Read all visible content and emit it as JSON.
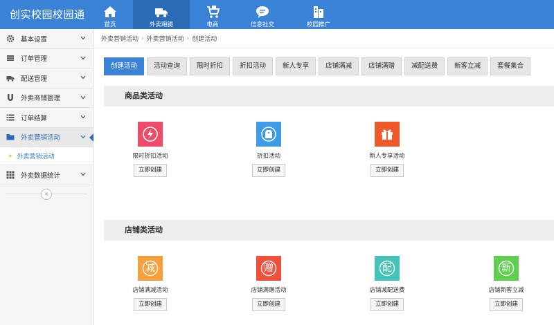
{
  "brand": "创实校园校园通",
  "topnav": [
    {
      "label": "首页",
      "icon": "home-icon"
    },
    {
      "label": "外卖跑腿",
      "icon": "delivery-truck-icon",
      "active": true
    },
    {
      "label": "电商",
      "icon": "cart-icon"
    },
    {
      "label": "信息社交",
      "icon": "chat-bubble-icon"
    },
    {
      "label": "校园推广",
      "icon": "building-icon"
    }
  ],
  "sidebar": {
    "items": [
      {
        "label": "基本设置",
        "icon": "gear-icon"
      },
      {
        "label": "订单管理",
        "icon": "order-list-icon"
      },
      {
        "label": "配送管理",
        "icon": "truck-icon"
      },
      {
        "label": "外卖商铺管理",
        "icon": "magnet-icon"
      },
      {
        "label": "订单结算",
        "icon": "list-icon"
      },
      {
        "label": "外卖营销活动",
        "icon": "folder-icon",
        "active": true
      },
      {
        "label": "外卖数据统计",
        "icon": "grid-icon"
      }
    ],
    "sub_item": {
      "label": "外卖营销活动",
      "arrow": "»"
    },
    "collapse_glyph": "«"
  },
  "breadcrumb": [
    "外卖营销活动",
    "外卖营销活动",
    "创建活动"
  ],
  "breadcrumb_sep": "›",
  "tabs": [
    "创建活动",
    "活动查询",
    "限时折扣",
    "折扣活动",
    "新人专享",
    "店铺满减",
    "店铺满赠",
    "减配送费",
    "新客立减",
    "套餐集合"
  ],
  "sections": [
    {
      "title": "商品类活动",
      "cards": [
        {
          "label": "限时折扣活动",
          "button": "立即创建",
          "color": "#ef4a67",
          "icon": "lightning-icon",
          "glyph": "⚡"
        },
        {
          "label": "折扣活动",
          "button": "立即创建",
          "color": "#3d9be9",
          "icon": "price-tag-icon",
          "glyph": "$"
        },
        {
          "label": "新人专享活动",
          "button": "立即创建",
          "color": "#f05a2a",
          "icon": "gift-icon",
          "glyph": "🎁"
        }
      ]
    },
    {
      "title": "店铺类活动",
      "cards": [
        {
          "label": "店铺满减活动",
          "button": "立即创建",
          "color": "#f5a03c",
          "icon": "discount-icon",
          "glyph": "减"
        },
        {
          "label": "店铺满赠活动",
          "button": "立即创建",
          "color": "#f0513c",
          "icon": "gift-badge-icon",
          "glyph": "赠"
        },
        {
          "label": "店铺减配送费",
          "button": "立即创建",
          "color": "#45c3b8",
          "icon": "delivery-badge-icon",
          "glyph": "配"
        },
        {
          "label": "店铺新客立减",
          "button": "立即创建",
          "color": "#5fcf4f",
          "icon": "new-customer-icon",
          "glyph": "新"
        }
      ]
    }
  ]
}
